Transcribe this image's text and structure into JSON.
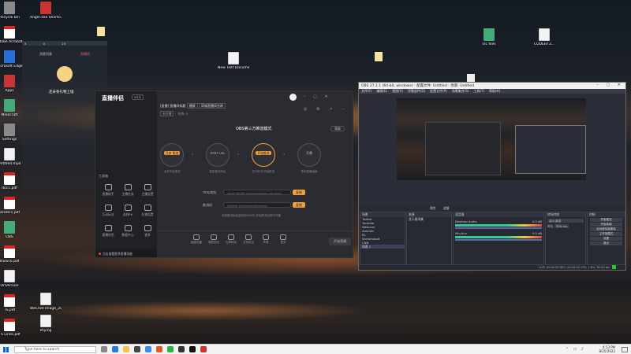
{
  "desktop": {
    "left_icons": [
      {
        "label": "Recycle Bin",
        "kind": "grey"
      },
      {
        "label": "Adobe Acrobat",
        "kind": "pdf"
      },
      {
        "label": "Microsoft Edge",
        "kind": "blue"
      },
      {
        "label": "Apps",
        "kind": "app"
      },
      {
        "label": "Minecraft",
        "kind": "green"
      },
      {
        "label": "Settings",
        "kind": "grey"
      },
      {
        "label": "Untitled.mp4",
        "kind": "file"
      },
      {
        "label": "doc1.pdf",
        "kind": "pdf"
      },
      {
        "label": "Binder1.pdf",
        "kind": "pdf"
      },
      {
        "label": "OBS",
        "kind": "green"
      },
      {
        "label": "Invoice.pdf",
        "kind": "pdf"
      },
      {
        "label": "OnVersion",
        "kind": "file"
      },
      {
        "label": "TS.pdf",
        "kind": "pdf"
      },
      {
        "label": "TS Lines.pdf",
        "kind": "pdf"
      }
    ],
    "col2_icons": [
      {
        "label": "Angle.exe Shortcut",
        "kind": "app"
      },
      {
        "label": "WeChat Image_202...",
        "kind": "file"
      },
      {
        "label": "zhying",
        "kind": "file"
      }
    ],
    "scattered_icons": [
      {
        "label": "New Text Document",
        "kind": "file"
      },
      {
        "label": "src files",
        "kind": "file"
      },
      {
        "label": "CODEBT3...",
        "kind": "file"
      }
    ]
  },
  "overlay_panel": {
    "tabs": [
      "消息列表",
      "直播间"
    ],
    "message": "还未有礼物上墙",
    "counts": [
      "5",
      "0",
      "23"
    ]
  },
  "stream_app": {
    "logo": "直播伴侣",
    "version": "v4.6",
    "room": {
      "tag": "[直播]",
      "title": "直播间标题",
      "badge": "横屏",
      "category": "同城直播间名称",
      "status": "未开播",
      "online": "在线: 0"
    },
    "side_tools": [
      {
        "label": "直播助手"
      },
      {
        "label": "主播任务"
      },
      {
        "label": "主播设置"
      },
      {
        "label": "互动玩法"
      },
      {
        "label": "连线PK"
      },
      {
        "label": "礼物设置"
      },
      {
        "label": "直播伴侣"
      },
      {
        "label": "数据中心"
      },
      {
        "label": "更多"
      }
    ],
    "sidebar_section": "工具箱",
    "sidebar_footer": "点击查看更多直播功能",
    "panel_title": "OBS第三方推流模式",
    "help_button": "帮助",
    "steps": [
      {
        "label": "开启\n推流",
        "caption": "点击开启推流"
      },
      {
        "label": "RTMP URL",
        "caption": "复制推流地址"
      },
      {
        "label": "开始推流",
        "caption": "在OBS中开始推流"
      },
      {
        "label": "开播",
        "caption": "等待直播画面"
      }
    ],
    "fields": [
      {
        "label": "rtmp地址",
        "value": "rtmp://push-rtmp.example.com/live/",
        "button": "复制"
      },
      {
        "label": "推流码",
        "value": "stream-xxxxxxxxxxxxxxxx",
        "button": "复制"
      }
    ],
    "field_hint": "请将推流地址复制到OBS中,开始推流后即可开播",
    "bottom_tools": [
      "画面设置",
      "美颜特效",
      "礼物特效",
      "互动玩法",
      "声音",
      "更多"
    ],
    "start_button": "开始直播"
  },
  "obs": {
    "title": "OBS 27.2.1 (64-bit, windows) - 配置文件: Untitled - 场景: Untitled",
    "menu": [
      "文件(F)",
      "编辑(E)",
      "视图(V)",
      "停靠部件(D)",
      "配置文件(P)",
      "场景集合(S)",
      "工具(T)",
      "帮助(H)"
    ],
    "source_bar": [
      "属性",
      "滤镜"
    ],
    "scenes_title": "场景",
    "scenes": [
      "Twitter",
      "Youtube",
      "Webcam",
      "Animals",
      "BL",
      "Streamboat",
      "CNN",
      "场景 1"
    ],
    "sources_title": "来源",
    "sources": [
      "显示器采集"
    ],
    "mixer_title": "混音器",
    "mixer": [
      {
        "name": "Desktop Audio",
        "db": "0.0 dB"
      },
      {
        "name": "Mic/Aux",
        "db": "0.0 dB"
      }
    ],
    "transitions_title": "转场特效",
    "transition": "淡入淡出",
    "duration_label": "时长",
    "duration": "300 ms",
    "controls_title": "控制",
    "controls": [
      "开始推流",
      "开始录制",
      "启动虚拟摄像机",
      "工作室模式",
      "设置",
      "退出"
    ],
    "status": "LIVE: 00:00:00   REC: 00:00:00   CPU: 1.8%, 60.00 fps"
  },
  "taskbar": {
    "search_placeholder": "Type here to search",
    "time": "4:13 PM",
    "date": "8/25/2022"
  }
}
